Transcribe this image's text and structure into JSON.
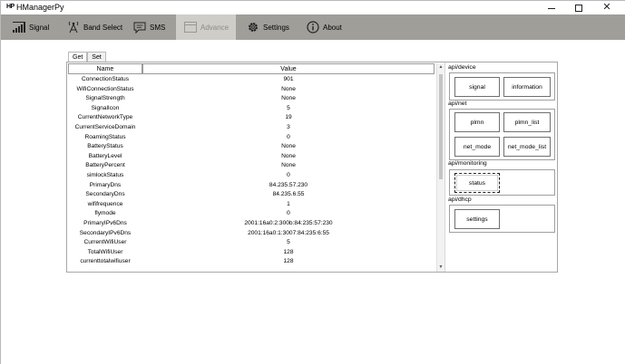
{
  "window": {
    "icon_text": "HP",
    "title": "HManagerPy",
    "minimize_glyph": "",
    "maximize_glyph": "",
    "close_glyph": "✕"
  },
  "tabs": [
    {
      "label": "Signal",
      "icon": "signal-bars-icon",
      "state": "normal"
    },
    {
      "label": "Band Select",
      "icon": "tower-icon",
      "state": "normal"
    },
    {
      "label": "SMS",
      "icon": "message-icon",
      "state": "normal"
    },
    {
      "label": "Advance",
      "icon": "window-icon",
      "state": "disabled"
    },
    {
      "label": "Settings",
      "icon": "gear-icon",
      "state": "normal"
    },
    {
      "label": "About",
      "icon": "info-icon",
      "state": "normal"
    }
  ],
  "subtabs": [
    {
      "label": "Get",
      "active": true
    },
    {
      "label": "Set",
      "active": false
    }
  ],
  "grid": {
    "headers": {
      "name": "Name",
      "value": "Value"
    },
    "rows": [
      {
        "name": "ConnectionStatus",
        "value": "901"
      },
      {
        "name": "WifiConnectionStatus",
        "value": "None"
      },
      {
        "name": "SignalStrength",
        "value": "None"
      },
      {
        "name": "SignalIcon",
        "value": "5"
      },
      {
        "name": "CurrentNetworkType",
        "value": "19"
      },
      {
        "name": "CurrentServiceDomain",
        "value": "3"
      },
      {
        "name": "RoamingStatus",
        "value": "0"
      },
      {
        "name": "BatteryStatus",
        "value": "None"
      },
      {
        "name": "BatteryLevel",
        "value": "None"
      },
      {
        "name": "BatteryPercent",
        "value": "None"
      },
      {
        "name": "simlockStatus",
        "value": "0"
      },
      {
        "name": "PrimaryDns",
        "value": "84.235.57.230"
      },
      {
        "name": "SecondaryDns",
        "value": "84.235.6.55"
      },
      {
        "name": "wififrequence",
        "value": "1"
      },
      {
        "name": "flymode",
        "value": "0"
      },
      {
        "name": "PrimaryIPv6Dns",
        "value": "2001:16a0:2:300b:84:235:57:230"
      },
      {
        "name": "SecondaryIPv6Dns",
        "value": "2001:16a0:1:3007:84:235:6:55"
      },
      {
        "name": "CurrentWifiUser",
        "value": "5"
      },
      {
        "name": "TotalWifiUser",
        "value": "128"
      },
      {
        "name": "currenttotalwifiuser",
        "value": "128"
      }
    ]
  },
  "scrollbar": {
    "up_glyph": "▲",
    "down_glyph": "▼"
  },
  "api_groups": [
    {
      "title": "api/device",
      "buttons": [
        "signal",
        "information"
      ]
    },
    {
      "title": "api/net",
      "buttons": [
        "plmn",
        "plmn_list",
        "net_mode",
        "net_mode_list"
      ]
    },
    {
      "title": "api/monitoring",
      "buttons": [
        "status"
      ]
    },
    {
      "title": "api/dhcp",
      "buttons": [
        "settings"
      ]
    }
  ],
  "colors": {
    "tabbar": "#a09e99",
    "tab_disabled": "#cfcdc8",
    "border": "#a7a7a7"
  }
}
